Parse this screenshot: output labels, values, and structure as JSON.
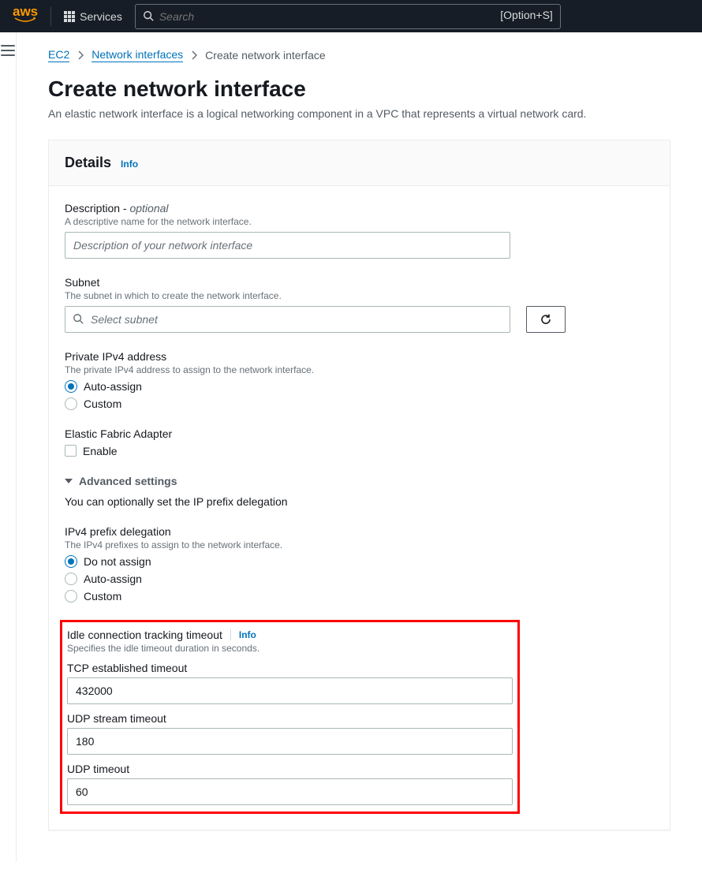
{
  "nav": {
    "services_label": "Services",
    "search_placeholder": "Search",
    "search_hint": "[Option+S]"
  },
  "breadcrumb": {
    "root": "EC2",
    "mid": "Network interfaces",
    "current": "Create network interface"
  },
  "page": {
    "title": "Create network interface",
    "subtitle": "An elastic network interface is a logical networking component in a VPC that represents a virtual network card."
  },
  "panel": {
    "title": "Details",
    "info": "Info"
  },
  "description": {
    "label": "Description - ",
    "optional": "optional",
    "help": "A descriptive name for the network interface.",
    "placeholder": "Description of your network interface"
  },
  "subnet": {
    "label": "Subnet",
    "help": "The subnet in which to create the network interface.",
    "placeholder": "Select subnet"
  },
  "ipv4": {
    "label": "Private IPv4 address",
    "help": "The private IPv4 address to assign to the network interface.",
    "opt_auto": "Auto-assign",
    "opt_custom": "Custom"
  },
  "efa": {
    "label": "Elastic Fabric Adapter",
    "opt_enable": "Enable"
  },
  "advanced": {
    "label": "Advanced settings",
    "note": "You can optionally set the IP prefix delegation"
  },
  "prefix": {
    "label": "IPv4 prefix delegation",
    "help": "The IPv4 prefixes to assign to the network interface.",
    "opt_none": "Do not assign",
    "opt_auto": "Auto-assign",
    "opt_custom": "Custom"
  },
  "timeout": {
    "label": "Idle connection tracking timeout",
    "info": "Info",
    "help": "Specifies the idle timeout duration in seconds.",
    "tcp_label": "TCP established timeout",
    "tcp_value": "432000",
    "udp_stream_label": "UDP stream timeout",
    "udp_stream_value": "180",
    "udp_label": "UDP timeout",
    "udp_value": "60"
  }
}
